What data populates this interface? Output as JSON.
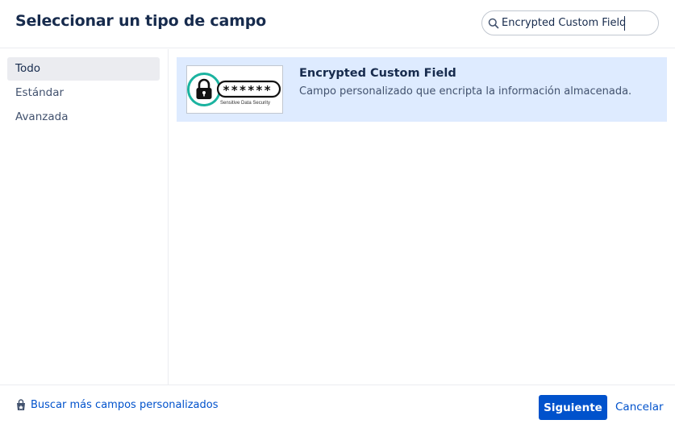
{
  "dialog": {
    "title": "Seleccionar un tipo de campo"
  },
  "search": {
    "value": "Encrypted Custom Field",
    "icon": "search-icon"
  },
  "sidebar": {
    "items": [
      {
        "label": "Todo",
        "active": true
      },
      {
        "label": "Estándar",
        "active": false
      },
      {
        "label": "Avanzada",
        "active": false
      }
    ]
  },
  "results": [
    {
      "title": "Encrypted Custom Field",
      "description": "Campo personalizado que encripta la información almacenada.",
      "thumbnail": {
        "mask": "******",
        "caption": "Sensitive Data Security",
        "icon": "padlock-icon"
      }
    }
  ],
  "footer": {
    "more_link": "Buscar más campos personalizados",
    "more_icon": "marketplace-bag-icon",
    "next_label": "Siguiente",
    "cancel_label": "Cancelar"
  },
  "colors": {
    "primary": "#0052cc",
    "selected_bg": "#deebff",
    "sidebar_active_bg": "#ebecf0",
    "text": "#172b4d",
    "thumbnail_accent": "#1bb3a0"
  }
}
